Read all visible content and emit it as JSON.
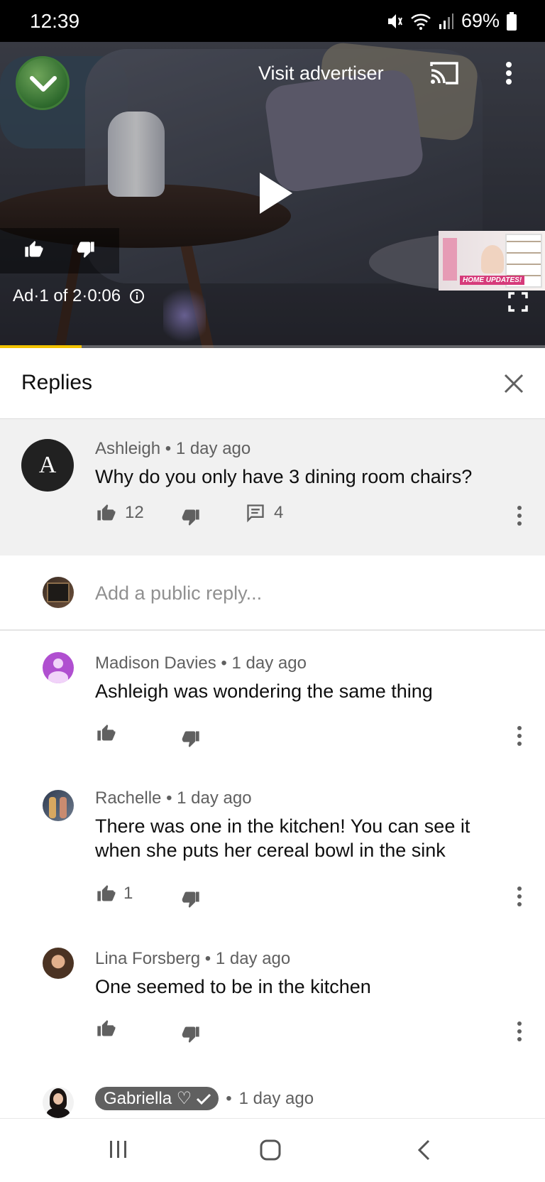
{
  "status_bar": {
    "time": "12:39",
    "battery": "69%"
  },
  "video": {
    "visit_advertiser": "Visit advertiser",
    "ad_info": "Ad·1 of 2·0:06",
    "thumbnail_label": "HOME UPDATES!",
    "progress": 0.15,
    "accent_color": "#f2c200"
  },
  "replies": {
    "title": "Replies",
    "parent": {
      "avatar_letter": "A",
      "author": "Ashleigh",
      "time": "1 day ago",
      "text": "Why do you only have 3 dining room chairs?",
      "likes": "12",
      "reply_count": "4"
    },
    "reply_placeholder": "Add a public reply...",
    "items": [
      {
        "author": "Madison Davies",
        "time": "1 day ago",
        "text": "Ashleigh was wondering the same thing",
        "likes": ""
      },
      {
        "author": "Rachelle",
        "time": "1 day ago",
        "text": "There was one in the kitchen! You can see it when she puts her cereal bowl in the sink",
        "likes": "1"
      },
      {
        "author": "Lina Forsberg",
        "time": "1 day ago",
        "text": "One seemed to be in the kitchen",
        "likes": ""
      },
      {
        "author": "Gabriella ♡",
        "time": "1 day ago",
        "text": ""
      }
    ]
  },
  "separator": "•",
  "icons": [
    "chevron-down-icon",
    "cast-icon",
    "more-vert-icon",
    "play-icon",
    "thumb-up-icon",
    "thumb-down-icon",
    "info-icon",
    "fullscreen-icon",
    "close-icon",
    "comment-icon",
    "check-icon",
    "recents-icon",
    "home-icon",
    "back-icon"
  ]
}
